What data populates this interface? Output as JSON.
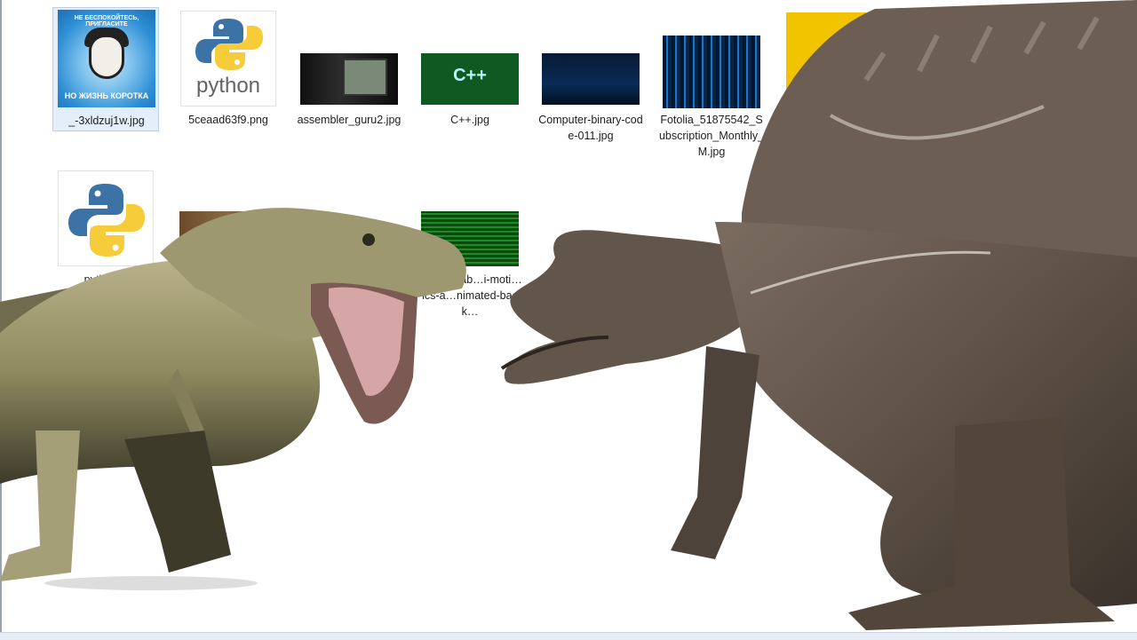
{
  "explorer": {
    "files": [
      {
        "name": "_-3xldzuj1w.jpg",
        "thumb": "meme",
        "caption_top": "НЕ БЕСПОКОЙТЕСЬ, ПРИГЛАСИТЕ",
        "caption_bottom": "НО ЖИЗНЬ КОРОТКА"
      },
      {
        "name": "5ceaad63f9.png",
        "thumb": "python",
        "logo_text": "python"
      },
      {
        "name": "assembler_guru2.jpg",
        "thumb": "assembler"
      },
      {
        "name": "C++.jpg",
        "thumb": "cpp",
        "logo_text": "C++"
      },
      {
        "name": "Computer-binary-code-011.jpg",
        "thumb": "binary"
      },
      {
        "name": "Fotolia_51875542_Subscription_Monthly_M.jpg",
        "thumb": "matrix"
      },
      {
        "name": "python-3",
        "thumb": "python"
      },
      {
        "name": "",
        "thumb": "brown"
      },
      {
        "name": "…otage-ab…i-moti…ics-a…nimated-back…",
        "thumb": "green"
      }
    ]
  },
  "overlay": {
    "left_creature": "tyrannosaurus",
    "right_creature": "spinosaurus"
  },
  "colors": {
    "selection": "#e4eefb",
    "trex_body": "#8f8a5f",
    "spino_body": "#5e5147"
  }
}
